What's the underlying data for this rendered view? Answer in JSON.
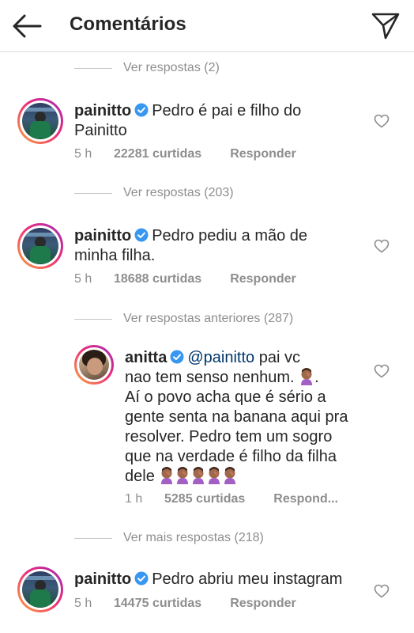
{
  "header": {
    "title": "Comentários",
    "back_icon": "arrow-left-icon",
    "share_icon": "paper-plane-icon"
  },
  "view_replies": [
    "Ver respostas (2)",
    "Ver respostas (203)",
    "Ver respostas anteriores (287)",
    "Ver mais respostas (218)"
  ],
  "comments": [
    {
      "username": "painitto",
      "text_line1": "Pedro é pai e filho do",
      "text_line2": "Painitto",
      "time": "5 h",
      "likes": "22281 curtidas",
      "reply": "Responder"
    },
    {
      "username": "painitto",
      "text_line1": "Pedro pediu a mão de",
      "text_line2": "minha filha.",
      "time": "5 h",
      "likes": "18688 curtidas",
      "reply": "Responder"
    },
    {
      "username": "anitta",
      "mention": "@painitto",
      "text_line1": " pai vc",
      "text_line2": "nao tem senso nenhum.",
      "text_line3": "Aí o povo acha que é sério a",
      "text_line4": "gente senta na banana aqui pra",
      "text_line5": "resolver. Pedro tem um sogro",
      "text_line6": "que na verdade é filho da filha",
      "text_line7": "dele",
      "time": "1 h",
      "likes": "5285 curtidas",
      "reply": "Respond..."
    },
    {
      "username": "painitto",
      "text_line1": "Pedro abriu meu instagram",
      "time": "5 h",
      "likes": "14475 curtidas",
      "reply": "Responder"
    }
  ],
  "colors": {
    "text": "#262626",
    "muted": "#8e8e8e",
    "verified": "#3897f0",
    "mention": "#00376b",
    "divider": "#dbdbdb"
  }
}
